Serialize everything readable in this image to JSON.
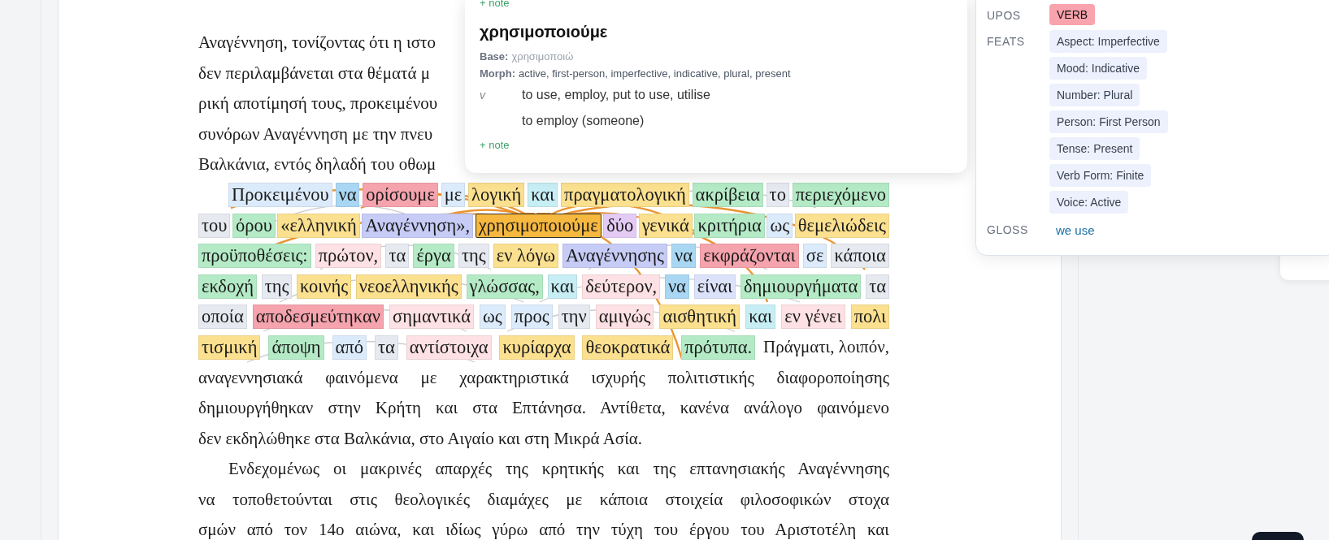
{
  "document": {
    "cut_lines": [
      "Αναγέννηση, τονίζοντας ότι η ιστο",
      "δεν περιλαμβάνεται στα θέματά μ",
      "ρική αποτίμησή τους, προκειμένου",
      "συνόρων Αναγέννηση με την πνευ",
      "Βαλκάνια, εντός δηλαδή του οθωμ"
    ],
    "annotated_lines": [
      {
        "tokens": [
          {
            "text": "Προκειμένου",
            "color": "#dcebfb",
            "selected": false
          },
          {
            "text": "να",
            "color": "#a9d7f3",
            "selected": false
          },
          {
            "text": "ορίσουμε",
            "color": "#f5a3ad",
            "selected": false
          },
          {
            "text": "με",
            "color": "#dcebfb",
            "selected": false
          },
          {
            "text": "λογική",
            "color": "#fbe08f",
            "selected": false
          },
          {
            "text": "και",
            "color": "#c6eef4",
            "selected": false
          },
          {
            "text": "πραγματολογική",
            "color": "#fbe08f",
            "selected": false
          },
          {
            "text": "ακρίβεια",
            "color": "#b4ebc6",
            "selected": false
          },
          {
            "text": "το",
            "color": "#e6eaf0",
            "selected": false
          },
          {
            "text": "περιεχόμενο",
            "color": "#b4ebc6",
            "selected": false
          }
        ]
      },
      {
        "tokens": [
          {
            "text": "του",
            "color": "#e6eaf0",
            "selected": false
          },
          {
            "text": "όρου",
            "color": "#b4ebc6",
            "selected": false
          },
          {
            "text": "«ελληνική",
            "color": "#fbe08f",
            "selected": false
          },
          {
            "text": "Αναγέννηση»,",
            "color": "#c6ccf6",
            "selected": false
          },
          {
            "text": "χρησιμοποιούμε",
            "color": "#f6b83e",
            "selected": true
          },
          {
            "text": "δύο",
            "color": "#e4cbf6",
            "selected": false
          },
          {
            "text": "γενικά",
            "color": "#fbe08f",
            "selected": false
          },
          {
            "text": "κριτήρια",
            "color": "#b4ebc6",
            "selected": false
          },
          {
            "text": "ως",
            "color": "#dcebfb",
            "selected": false
          },
          {
            "text": "θεμελιώδεις",
            "color": "#fbe08f",
            "selected": false
          }
        ]
      },
      {
        "tokens": [
          {
            "text": "προϋποθέσεις:",
            "color": "#b4ebc6",
            "selected": false
          },
          {
            "text": "πρώτον,",
            "color": "#fde1e4",
            "selected": false
          },
          {
            "text": "τα",
            "color": "#e6eaf0",
            "selected": false
          },
          {
            "text": "έργα",
            "color": "#b4ebc6",
            "selected": false
          },
          {
            "text": "της",
            "color": "#e6eaf0",
            "selected": false
          },
          {
            "text": "εν λόγω",
            "color": "#fbe08f",
            "selected": false
          },
          {
            "text": "Αναγέννησης",
            "color": "#c6ccf6",
            "selected": false
          },
          {
            "text": "να",
            "color": "#a9d7f3",
            "selected": false
          },
          {
            "text": "εκφράζονται",
            "color": "#f5a3ad",
            "selected": false
          },
          {
            "text": "σε",
            "color": "#dcebfb",
            "selected": false
          },
          {
            "text": "κάποια",
            "color": "#e6eaf0",
            "selected": false
          }
        ]
      },
      {
        "tokens": [
          {
            "text": "εκδοχή",
            "color": "#b4ebc6",
            "selected": false
          },
          {
            "text": "της",
            "color": "#e6eaf0",
            "selected": false
          },
          {
            "text": "κοινής",
            "color": "#fbe08f",
            "selected": false
          },
          {
            "text": "νεοελληνικής",
            "color": "#fbe08f",
            "selected": false
          },
          {
            "text": "γλώσσας,",
            "color": "#b4ebc6",
            "selected": false
          },
          {
            "text": "και",
            "color": "#c6eef4",
            "selected": false
          },
          {
            "text": "δεύτερον,",
            "color": "#fde1e4",
            "selected": false
          },
          {
            "text": "να",
            "color": "#a9d7f3",
            "selected": false
          },
          {
            "text": "είναι",
            "color": "#dde2fb",
            "selected": false
          },
          {
            "text": "δημιουργήματα",
            "color": "#b4ebc6",
            "selected": false
          },
          {
            "text": "τα",
            "color": "#e6eaf0",
            "selected": false
          }
        ]
      },
      {
        "tokens": [
          {
            "text": "οποία",
            "color": "#e6eaf0",
            "selected": false
          },
          {
            "text": "αποδεσμεύτηκαν",
            "color": "#f5a3ad",
            "selected": false
          },
          {
            "text": "σημαντικά",
            "color": "#fde1e4",
            "selected": false
          },
          {
            "text": "ως",
            "color": "#dcebfb",
            "selected": false
          },
          {
            "text": "προς",
            "color": "#dcebfb",
            "selected": false
          },
          {
            "text": "την",
            "color": "#e6eaf0",
            "selected": false
          },
          {
            "text": "αμιγώς",
            "color": "#fde1e4",
            "selected": false
          },
          {
            "text": "αισθητική",
            "color": "#fbe08f",
            "selected": false
          },
          {
            "text": "και",
            "color": "#c6eef4",
            "selected": false
          },
          {
            "text": "εν γένει",
            "color": "#fde1e4",
            "selected": false
          },
          {
            "text": "πολι",
            "color": "#fbe08f",
            "selected": false
          }
        ]
      },
      {
        "tokens": [
          {
            "text": "τισμική",
            "color": "#fbe08f",
            "selected": false
          },
          {
            "text": "άποψη",
            "color": "#b4ebc6",
            "selected": false
          },
          {
            "text": "από",
            "color": "#dcebfb",
            "selected": false
          },
          {
            "text": "τα",
            "color": "#e6eaf0",
            "selected": false
          },
          {
            "text": "αντίστοιχα",
            "color": "#fde1e4",
            "selected": false
          },
          {
            "text": "κυρίαρχα",
            "color": "#fbe08f",
            "selected": false
          },
          {
            "text": "θεοκρατικά",
            "color": "#fbe08f",
            "selected": false
          },
          {
            "text": "πρότυπα.",
            "color": "#b4ebc6",
            "selected": false
          }
        ],
        "trailing_text": "Πράγματι, λοιπόν,"
      }
    ],
    "tail_lines": [
      "αναγεννησιακά φαινόμενα με χαρακτηριστικά ισχυρής πολιτιστικής διαφοροποίησης",
      "δημιουργήθηκαν στην Κρήτη και στα Επτάνησα. Αντίθετα, κανένα ανάλογο φαινόμενο",
      "δεν εκδηλώθηκε στα Βαλκάνια, στο Αιγαίο και στη Μικρά Ασία."
    ],
    "next_paragraph_lines": [
      "Ενδεχομένως οι μακρινές απαρχές της κρητικής και της επτανησιακής Αναγέννησης",
      "να τοποθετούνται στις θεολογικές διαμάχες με κάποια στοιχεία φιλοσοφικών στοχα",
      "σμών από τον 14ο αιώνα, και ιδίως γύρω από την τύχη του έργου του Αριστοτέλη και"
    ]
  },
  "word_popup": {
    "top_note": "+ note",
    "headword": "χρησιμοποιούμε",
    "base_label": "Base:",
    "base": "χρησιμοποιώ",
    "morph_label": "Morph:",
    "morph": "active, first-person, imperfective, indicative, plural, present",
    "senses": [
      {
        "pos": "v",
        "gloss": "to use, employ, put to use, utilise"
      },
      {
        "gloss": "to employ (someone)"
      }
    ],
    "note": "+ note"
  },
  "analysis_panel": {
    "upos_label": "UPOS",
    "upos": "VERB",
    "feats_label": "FEATS",
    "feats": [
      "Aspect: Imperfective",
      "Mood: Indicative",
      "Number: Plural",
      "Person: First Person",
      "Tense: Present",
      "Verb Form: Finite",
      "Voice: Active"
    ],
    "gloss_label": "GLOSS",
    "gloss": "we use"
  }
}
